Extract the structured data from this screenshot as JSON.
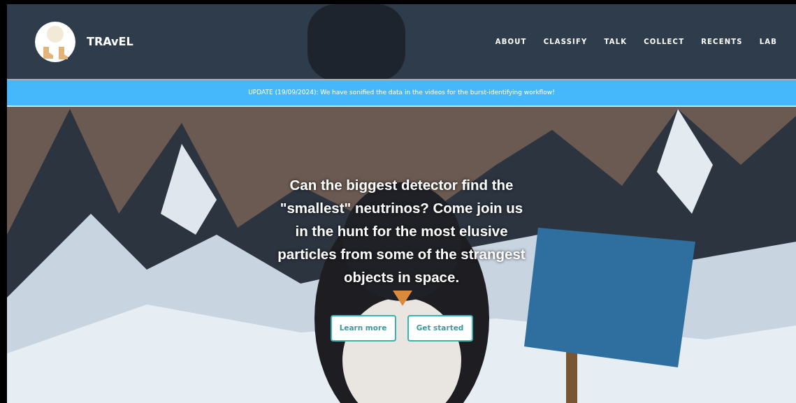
{
  "header": {
    "brand": "TRAvEL",
    "nav": [
      {
        "label": "ABOUT"
      },
      {
        "label": "CLASSIFY"
      },
      {
        "label": "TALK"
      },
      {
        "label": "COLLECT"
      },
      {
        "label": "RECENTS"
      },
      {
        "label": "LAB"
      }
    ]
  },
  "banner": {
    "text": "UPDATE (19/09/2024): We have sonified the data in the videos for the burst-identifying workflow!"
  },
  "hero": {
    "headline": "Can the biggest detector find the \"smallest\" neutrinos? Come join us in the hunt for the most elusive particles from some of the strangest objects in space.",
    "buttons": [
      "Learn more",
      "Get started"
    ]
  }
}
